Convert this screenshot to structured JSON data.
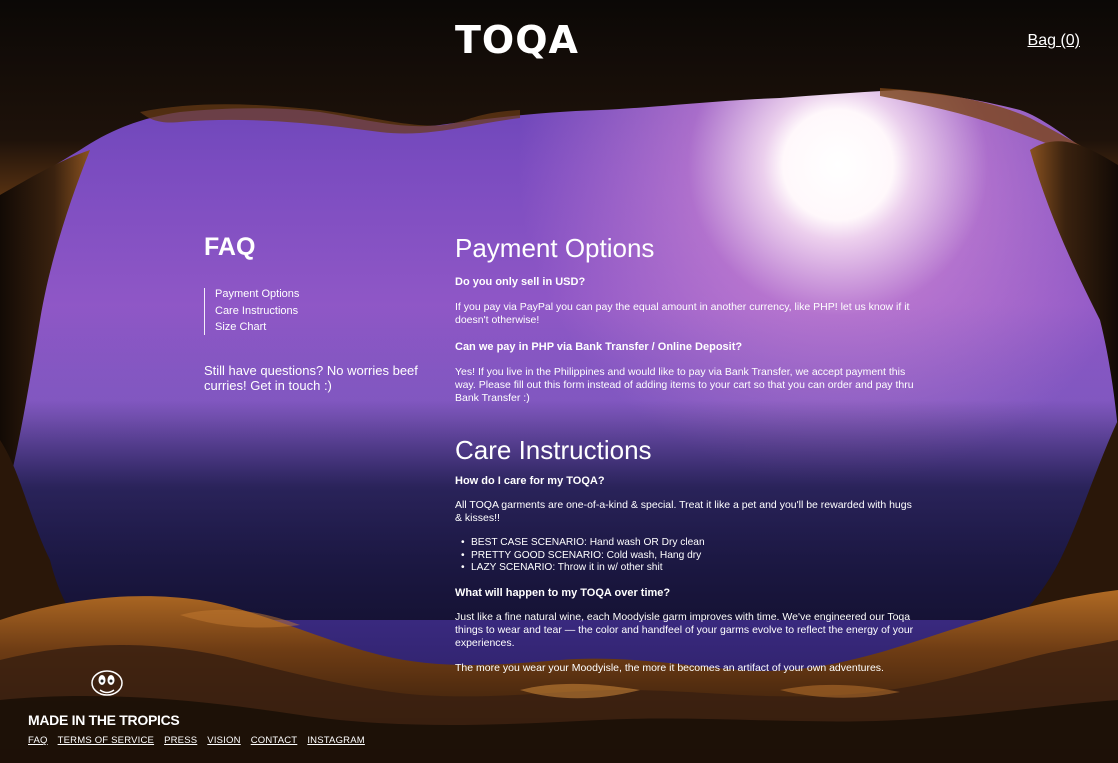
{
  "header": {
    "logo": "TOQA",
    "bag": "Bag (0)"
  },
  "faq": {
    "title": "FAQ",
    "nav": [
      "Payment Options",
      "Care Instructions",
      "Size Chart"
    ],
    "contact_note": "Still have questions? No worries beef curries! Get in touch :)"
  },
  "payment": {
    "title": "Payment Options",
    "q1": "Do you only sell in USD?",
    "a1": "If you pay via PayPal you can pay the equal amount in another currency, like PHP! let us know if it doesn't otherwise!",
    "q2": "Can we pay in PHP via Bank Transfer / Online Deposit?",
    "a2": "Yes! If you live in the Philippines and would like to pay via Bank Transfer, we accept payment this way. Please fill out this form instead of adding items to your cart so that you can order and pay thru Bank Transfer :)"
  },
  "care": {
    "title": "Care Instructions",
    "q1": "How do I care for my TOQA?",
    "a1": "All TOQA garments are one-of-a-kind & special. Treat it like a pet and you'll be rewarded with hugs & kisses!!",
    "bullets": [
      "BEST CASE SCENARIO: Hand wash OR Dry clean",
      "PRETTY GOOD SCENARIO: Cold wash, Hang dry",
      "LAZY SCENARIO: Throw it in w/ other shit"
    ],
    "q2": "What will happen to my TOQA over time?",
    "a2": "Just like a fine natural wine, each Moodyisle garm improves with time. We've engineered our Toqa things to wear and tear — the color and handfeel of your garms evolve to reflect the energy of your experiences.",
    "a3": "The more you wear your Moodyisle, the more it becomes an artifact of your own adventures."
  },
  "footer": {
    "made": "MADE IN THE TROPICS",
    "links": [
      "FAQ",
      "TERMS OF SERVICE",
      "PRESS",
      "VISION",
      "CONTACT",
      "INSTAGRAM"
    ]
  }
}
